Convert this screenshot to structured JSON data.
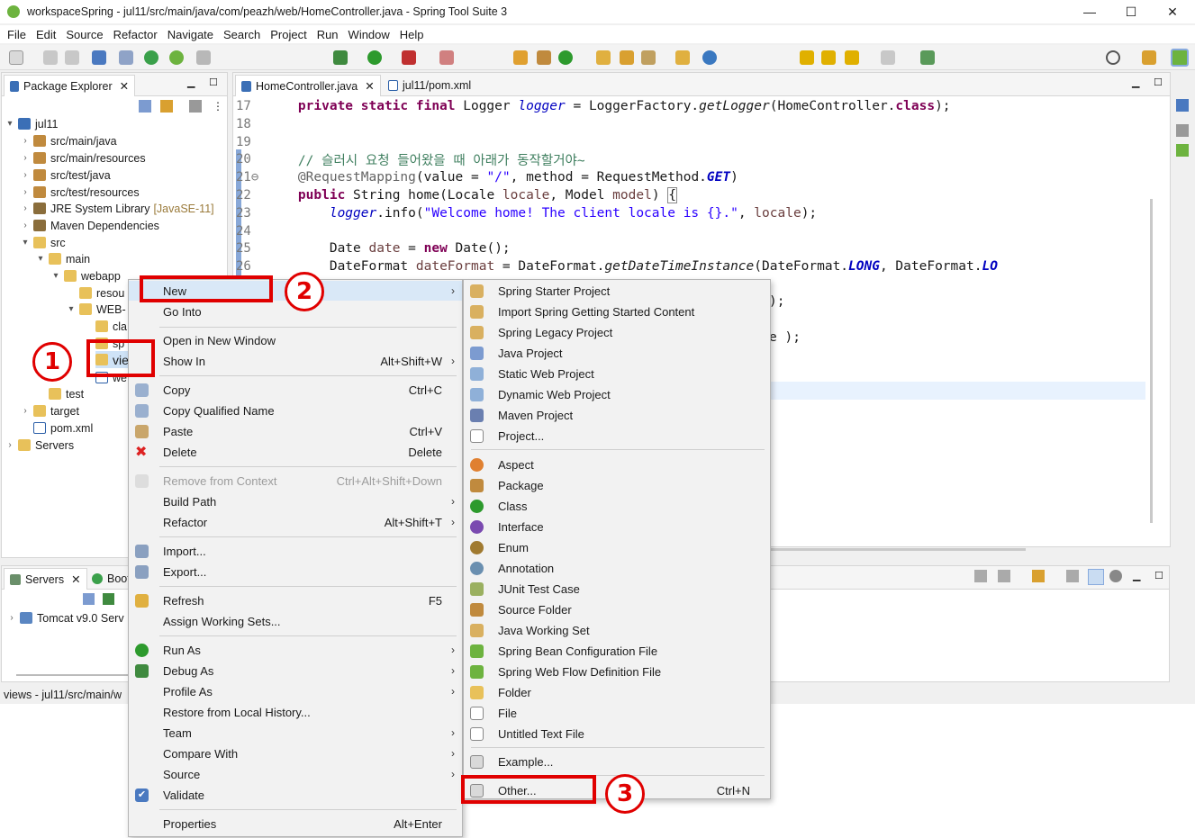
{
  "window": {
    "title": "workspaceSpring - jul11/src/main/java/com/peazh/web/HomeController.java - Spring Tool Suite 3",
    "minimize": "—",
    "maximize": "☐",
    "close": "✕"
  },
  "menubar": [
    "File",
    "Edit",
    "Source",
    "Refactor",
    "Navigate",
    "Search",
    "Project",
    "Run",
    "Window",
    "Help"
  ],
  "package_explorer": {
    "tab_label": "Package Explorer",
    "tree": [
      {
        "label": "jul11",
        "icon": "project-icon"
      },
      {
        "label": "src/main/java",
        "icon": "package-folder-icon"
      },
      {
        "label": "src/main/resources",
        "icon": "package-folder-icon"
      },
      {
        "label": "src/test/java",
        "icon": "package-folder-icon"
      },
      {
        "label": "src/test/resources",
        "icon": "package-folder-icon"
      },
      {
        "label": "JRE System Library",
        "decoration": "[JavaSE-11]",
        "icon": "library-icon"
      },
      {
        "label": "Maven Dependencies",
        "icon": "library-icon"
      },
      {
        "label": "src",
        "icon": "folder-icon"
      },
      {
        "label": "main",
        "icon": "folder-icon"
      },
      {
        "label": "webapp",
        "icon": "folder-icon"
      },
      {
        "label": "resou",
        "icon": "folder-icon"
      },
      {
        "label": "WEB-",
        "icon": "folder-icon"
      },
      {
        "label": "cla",
        "icon": "folder-icon"
      },
      {
        "label": "sp",
        "icon": "folder-icon"
      },
      {
        "label": "view",
        "icon": "folder-icon"
      },
      {
        "label": "we",
        "icon": "xml-file-icon"
      },
      {
        "label": "test",
        "icon": "folder-icon"
      },
      {
        "label": "target",
        "icon": "folder-icon"
      },
      {
        "label": "pom.xml",
        "icon": "xml-file-icon"
      },
      {
        "label": "Servers",
        "icon": "folder-icon"
      }
    ]
  },
  "editor": {
    "tabs": [
      {
        "label": "HomeController.java",
        "close": "✕"
      },
      {
        "label": "jul11/pom.xml"
      }
    ],
    "lines": [
      {
        "num": "17",
        "text": "    private static final Logger logger = LoggerFactory.getLogger(HomeController.class);"
      },
      {
        "num": "18",
        "text": ""
      },
      {
        "num": "19",
        "text": ""
      },
      {
        "num": "20",
        "text": "    // 슬러시 요청 들어왔을 때 아래가 동작할거야~"
      },
      {
        "num": "21⊖",
        "text": "    @RequestMapping(value = \"/\", method = RequestMethod.GET)"
      },
      {
        "num": "22",
        "text": "    public String home(Locale locale, Model model) {"
      },
      {
        "num": "23",
        "text": "        logger.info(\"Welcome home! The client locale is {}.\", locale);"
      },
      {
        "num": "24",
        "text": ""
      },
      {
        "num": "25",
        "text": "        Date date = new Date();"
      },
      {
        "num": "26",
        "text": "        DateFormat dateFormat = DateFormat.getDateTimeInstance(DateFormat.LONG, DateFormat.LO"
      }
    ],
    "partial_lines": [
      ");",
      "e );"
    ]
  },
  "servers_view": {
    "tabs": [
      "Servers",
      "Boot"
    ],
    "row": "Tomcat v9.0 Serv"
  },
  "statusbar": {
    "text": "views - jul11/src/main/w"
  },
  "context_menu": {
    "items": [
      {
        "label": "New",
        "arrow": "›",
        "icon": ""
      },
      {
        "label": "Go Into"
      },
      {
        "label": "Open in New Window"
      },
      {
        "label": "Show In",
        "shortcut": "Alt+Shift+W",
        "arrow": "›"
      },
      {
        "label": "Copy",
        "shortcut": "Ctrl+C",
        "icon": "copy-icon"
      },
      {
        "label": "Copy Qualified Name",
        "icon": "copy-icon"
      },
      {
        "label": "Paste",
        "shortcut": "Ctrl+V",
        "icon": "paste-icon"
      },
      {
        "label": "Delete",
        "shortcut": "Delete",
        "icon": "delete-icon"
      },
      {
        "label": "Remove from Context",
        "shortcut": "Ctrl+Alt+Shift+Down",
        "disabled": true
      },
      {
        "label": "Build Path",
        "arrow": "›"
      },
      {
        "label": "Refactor",
        "shortcut": "Alt+Shift+T",
        "arrow": "›"
      },
      {
        "label": "Import...",
        "icon": "import-icon"
      },
      {
        "label": "Export...",
        "icon": "export-icon"
      },
      {
        "label": "Refresh",
        "shortcut": "F5",
        "icon": "refresh-icon"
      },
      {
        "label": "Assign Working Sets..."
      },
      {
        "label": "Run As",
        "arrow": "›",
        "icon": "run-icon"
      },
      {
        "label": "Debug As",
        "arrow": "›",
        "icon": "debug-icon"
      },
      {
        "label": "Profile As",
        "arrow": "›"
      },
      {
        "label": "Restore from Local History..."
      },
      {
        "label": "Team",
        "arrow": "›"
      },
      {
        "label": "Compare With",
        "arrow": "›"
      },
      {
        "label": "Source",
        "arrow": "›"
      },
      {
        "label": "Validate",
        "icon": "checkbox-icon"
      },
      {
        "label": "Properties",
        "shortcut": "Alt+Enter"
      }
    ]
  },
  "submenu": {
    "items": [
      {
        "label": "Spring Starter Project"
      },
      {
        "label": "Import Spring Getting Started Content"
      },
      {
        "label": "Spring Legacy Project"
      },
      {
        "label": "Java Project"
      },
      {
        "label": "Static Web Project"
      },
      {
        "label": "Dynamic Web Project"
      },
      {
        "label": "Maven Project"
      },
      {
        "label": "Project..."
      },
      {
        "label": "Aspect"
      },
      {
        "label": "Package"
      },
      {
        "label": "Class"
      },
      {
        "label": "Interface"
      },
      {
        "label": "Enum"
      },
      {
        "label": "Annotation"
      },
      {
        "label": "JUnit Test Case"
      },
      {
        "label": "Source Folder"
      },
      {
        "label": "Java Working Set"
      },
      {
        "label": "Spring Bean Configuration File"
      },
      {
        "label": "Spring Web Flow Definition File"
      },
      {
        "label": "Folder"
      },
      {
        "label": "File"
      },
      {
        "label": "Untitled Text File"
      },
      {
        "label": "Example..."
      },
      {
        "label": "Other...",
        "shortcut": "Ctrl+N"
      }
    ]
  },
  "annotations": {
    "one": "1",
    "two": "2",
    "three": "3"
  },
  "colors": {
    "highlight_red": "#e00000",
    "spring_green": "#6db33f"
  }
}
